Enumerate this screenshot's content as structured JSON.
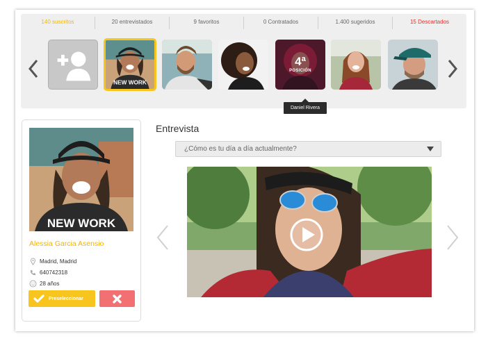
{
  "stats": [
    {
      "label": "140 suscritos",
      "state": "active"
    },
    {
      "label": "20 entrevistados",
      "state": "normal"
    },
    {
      "label": "9 favoritos",
      "state": "normal"
    },
    {
      "label": "0 Contratados",
      "state": "normal"
    },
    {
      "label": "1.400 sugeridos",
      "state": "normal"
    },
    {
      "label": "15 Descartados",
      "state": "discarded"
    }
  ],
  "colors": {
    "accent": "#f7c51e",
    "discard": "#f26f72",
    "active_stat": "#f5b800",
    "discarded_stat": "#e8302a",
    "panel": "#efefef"
  },
  "carousel": {
    "add_icon": "add-user-icon",
    "selected_shirt_text": "NEW WORK",
    "position_badge": {
      "number": "4ª",
      "label": "POSICIÓN"
    },
    "tooltip": "Daniel Rivera"
  },
  "profile": {
    "shirt_text": "NEW WORK",
    "name": "Alessia Garcia Asensio",
    "location": "Madrid, Madrid",
    "phone": "640742318",
    "age": "28 años",
    "preselect_label": "Preseleccionar",
    "icons": [
      "location-pin-icon",
      "phone-icon",
      "smiley-icon",
      "check-icon",
      "close-icon"
    ]
  },
  "interview": {
    "title": "Entrevista",
    "question": "¿Cómo es tu día a día actualmente?",
    "video_icon": "play-icon"
  }
}
